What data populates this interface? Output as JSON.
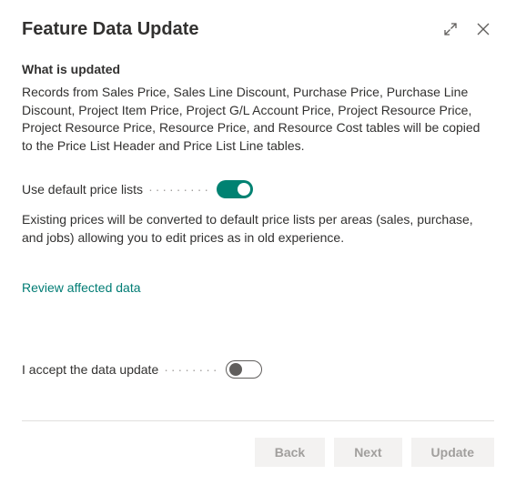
{
  "title": "Feature Data Update",
  "section_heading": "What is updated",
  "description": "Records from Sales Price, Sales Line Discount, Purchase Price, Purchase Line Discount, Project Item Price, Project G/L Account Price, Project Resource Price, Project Resource Price, Resource Price, and Resource Cost tables will be copied to the Price List Header and Price List Line tables.",
  "toggle1": {
    "label": "Use default price lists",
    "state": "on"
  },
  "helper_text": "Existing prices will be converted to default price lists per areas (sales, purchase, and jobs) allowing you to edit prices as in old experience.",
  "review_link": "Review affected data",
  "toggle2": {
    "label": "I accept the data update",
    "state": "off"
  },
  "buttons": {
    "back": "Back",
    "next": "Next",
    "update": "Update"
  }
}
